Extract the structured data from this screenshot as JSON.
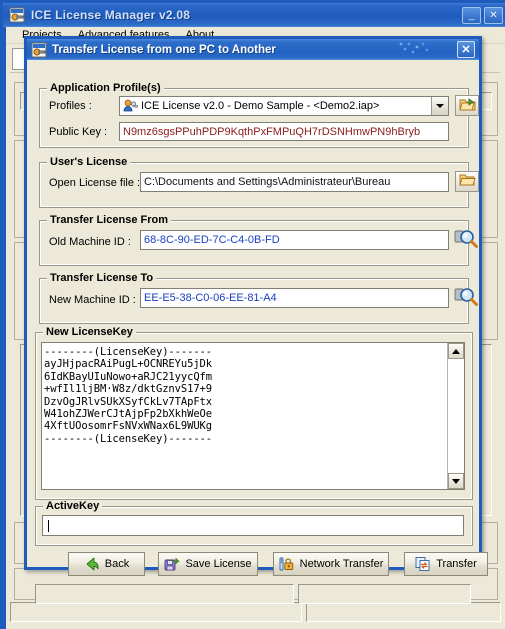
{
  "app": {
    "title": "ICE License Manager v2.08",
    "icon": "app-icon",
    "window_buttons": [
      {
        "name": "minimize-button",
        "glyph": "_"
      },
      {
        "name": "close-button",
        "glyph": "✕"
      }
    ],
    "menu": [
      {
        "name": "menu-projects",
        "label": "Projects"
      },
      {
        "name": "menu-advanced-features",
        "label": "Advanced features"
      },
      {
        "name": "menu-about",
        "label": "About"
      }
    ]
  },
  "dialog": {
    "title": "Transfer License from one PC to Another",
    "icon": "app-icon",
    "close_glyph": "✕",
    "application_profiles": {
      "title": "Application Profile(s)",
      "profiles_label": "Profiles :",
      "profiles_value": "ICE License v2.0 - Demo Sample - <Demo2.iap>",
      "profiles_icon": "profile-user-key-icon",
      "open_profile_icon": "open-folder-arrow-icon",
      "public_key_label": "Public Key :",
      "public_key_value": "N9mz6sgsPPuhPDP9KqthPxFMPuQH7rDSNHmwPN9hBryb",
      "public_key_color": "#8b1a1a"
    },
    "users_license": {
      "title": "User's License",
      "open_file_label": "Open License file :",
      "open_file_value": "C:\\Documents and Settings\\Administrateur\\Bureau",
      "browse_icon": "open-folder-icon"
    },
    "transfer_from": {
      "title": "Transfer License From",
      "machine_label": "Old Machine ID :",
      "machine_value": "68-8C-90-ED-7C-C4-0B-FD",
      "value_color": "#1b3fc0",
      "inspect_icon": "magnifier-icon"
    },
    "transfer_to": {
      "title": "Transfer License To",
      "machine_label": "New Machine ID :",
      "machine_value": "EE-E5-38-C0-06-EE-81-A4",
      "value_color": "#1b3fc0",
      "inspect_icon": "magnifier-icon"
    },
    "new_license_key": {
      "title": "New LicenseKey",
      "text": "--------(LicenseKey)-------\nayJHjpacRAiPugL+OCNREYu5jDk\n6IdKBayUIuNowo+aRJC21yycQfm\n+wfIl1ljBM·W8z/dktGznvS17+9\nDzvOgJRlvSUkXSyfCkLv7TApFtx\nW41ohZJWerCJtAjpFp2bXkhWeOe\n4XftUOosomrFsNVxWNax6L9WUKg\n--------(LicenseKey)-------",
      "scroll_up_icon": "scroll-up-arrow-icon",
      "scroll_down_icon": "scroll-down-arrow-icon"
    },
    "active_key": {
      "title": "ActiveKey",
      "value": "",
      "placeholder": ""
    },
    "buttons": [
      {
        "name": "back-button",
        "label": "Back",
        "icon": "green-back-arrow-icon"
      },
      {
        "name": "save-license-button",
        "label": "Save License",
        "icon": "save-disk-icon"
      },
      {
        "name": "network-transfer-button",
        "label": "Network Transfer",
        "icon": "network-lock-icon"
      },
      {
        "name": "transfer-button",
        "label": "Transfer",
        "icon": "transfer-pages-icon"
      }
    ]
  },
  "colors": {
    "title_blue": "#1f5bbd",
    "face": "#ece9d8",
    "key_red": "#8b1a1a",
    "id_blue": "#1b3fc0"
  }
}
